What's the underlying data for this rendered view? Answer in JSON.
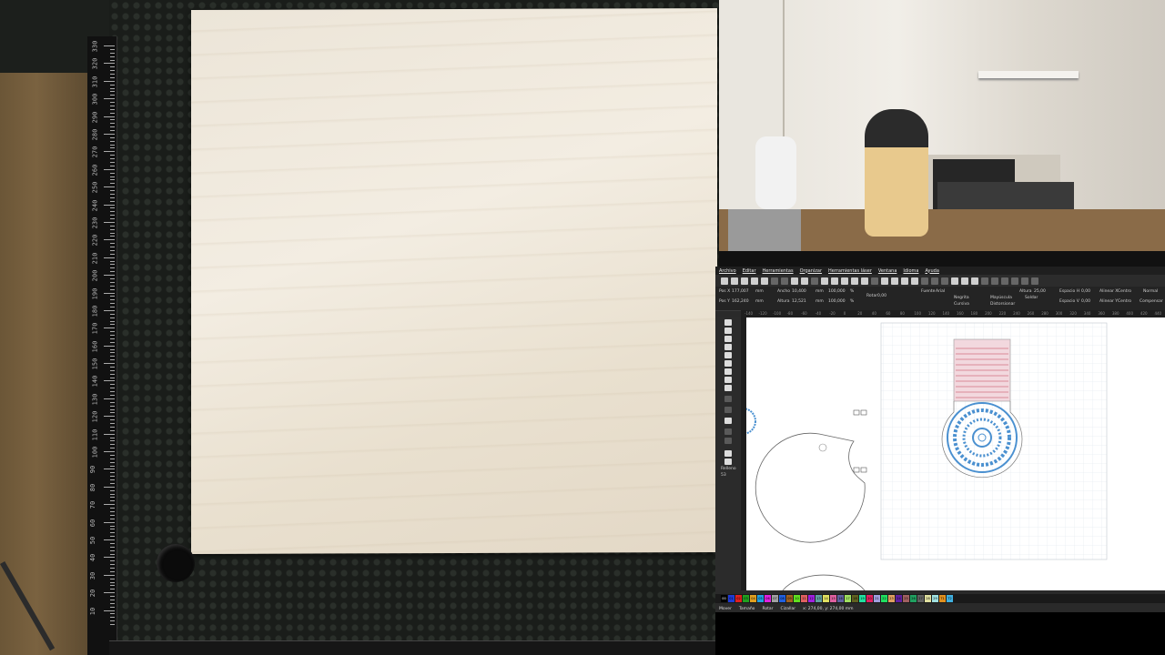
{
  "camera_left": {
    "ruler_marks": [
      "330",
      "320",
      "310",
      "300",
      "290",
      "280",
      "270",
      "260",
      "250",
      "240",
      "230",
      "220",
      "210",
      "200",
      "190",
      "180",
      "170",
      "160",
      "150",
      "140",
      "130",
      "120",
      "110",
      "100",
      "90",
      "80",
      "70",
      "60",
      "50",
      "40",
      "30",
      "20",
      "10"
    ]
  },
  "app": {
    "menu": [
      "Archivo",
      "Editar",
      "Herramientas",
      "Organizar",
      "Herramientas láser",
      "Ventana",
      "Idioma",
      "Ayuda"
    ],
    "props": {
      "pos_x_label": "Pos X",
      "pos_x_value": "177,007",
      "pos_y_label": "Pos Y",
      "pos_y_value": "162,240",
      "units1": "mm",
      "units2": "mm",
      "ancho_label": "Ancho",
      "ancho_value": "10,400",
      "alto_label": "Altura",
      "alto_value": "12,521",
      "mm3": "mm",
      "mm4": "mm",
      "pct1_value": "100,000",
      "pct2_value": "100,000",
      "pct_sign1": "%",
      "pct_sign2": "%",
      "rotar_label": "Rotar",
      "rotar_value": "0,00",
      "fuente_label": "Fuente",
      "fuente_value": "Arial",
      "altura_label": "Altura",
      "altura_value": "25,00",
      "negrita": "Negrita",
      "cursiva": "Cursiva",
      "mayus": "Mayúscula",
      "soldar": "Soldar",
      "distorsionar": "Distorsionar",
      "espacio_h": "Espacio H",
      "espacio_h_val": "0,00",
      "espacio_v": "Espacio V",
      "espacio_v_val": "0,00",
      "alinear_x": "Alinear X",
      "alinear_y": "Alinear Y",
      "centro1": "Centro",
      "centro2": "Centro",
      "normal": "Normal",
      "compensar": "Compensar"
    },
    "toolbox_label": "Relleno",
    "toolbox_value": "53",
    "ruler_top": [
      "-140",
      "-120",
      "-100",
      "-80",
      "-60",
      "-40",
      "-20",
      "0",
      "20",
      "40",
      "60",
      "80",
      "100",
      "120",
      "140",
      "160",
      "180",
      "200",
      "220",
      "240",
      "260",
      "280",
      "300",
      "320",
      "340",
      "360",
      "380",
      "400",
      "420",
      "440"
    ],
    "palette": [
      "00",
      "01",
      "02",
      "03",
      "04",
      "05",
      "06",
      "07",
      "08",
      "09",
      "10",
      "11",
      "12",
      "13",
      "14",
      "15",
      "16",
      "17",
      "18",
      "19",
      "20",
      "21",
      "22",
      "23",
      "24",
      "25",
      "26",
      "27",
      "28",
      "29",
      "T1",
      "T2"
    ],
    "palette_colors": [
      "#000000",
      "#1f3bd6",
      "#e02020",
      "#20a020",
      "#e0a020",
      "#20a0e0",
      "#e020e0",
      "#a0a0a0",
      "#2060e0",
      "#a06020",
      "#60e020",
      "#e06060",
      "#a020e0",
      "#60a0a0",
      "#e0e060",
      "#e060a0",
      "#6060a0",
      "#a0e060",
      "#606020",
      "#20e0a0",
      "#e02060",
      "#a0a0e0",
      "#20e060",
      "#e0a060",
      "#6020a0",
      "#a06060",
      "#20a060",
      "#606060",
      "#e0e0a0",
      "#a0e0e0",
      "#e09020",
      "#40b0e0"
    ],
    "status": {
      "mover": "Mover",
      "tamano": "Tamaño",
      "rotar": "Rotar",
      "cizallar": "Cizallar",
      "coords": "x: 274,00, y: 274,00 mm"
    }
  }
}
